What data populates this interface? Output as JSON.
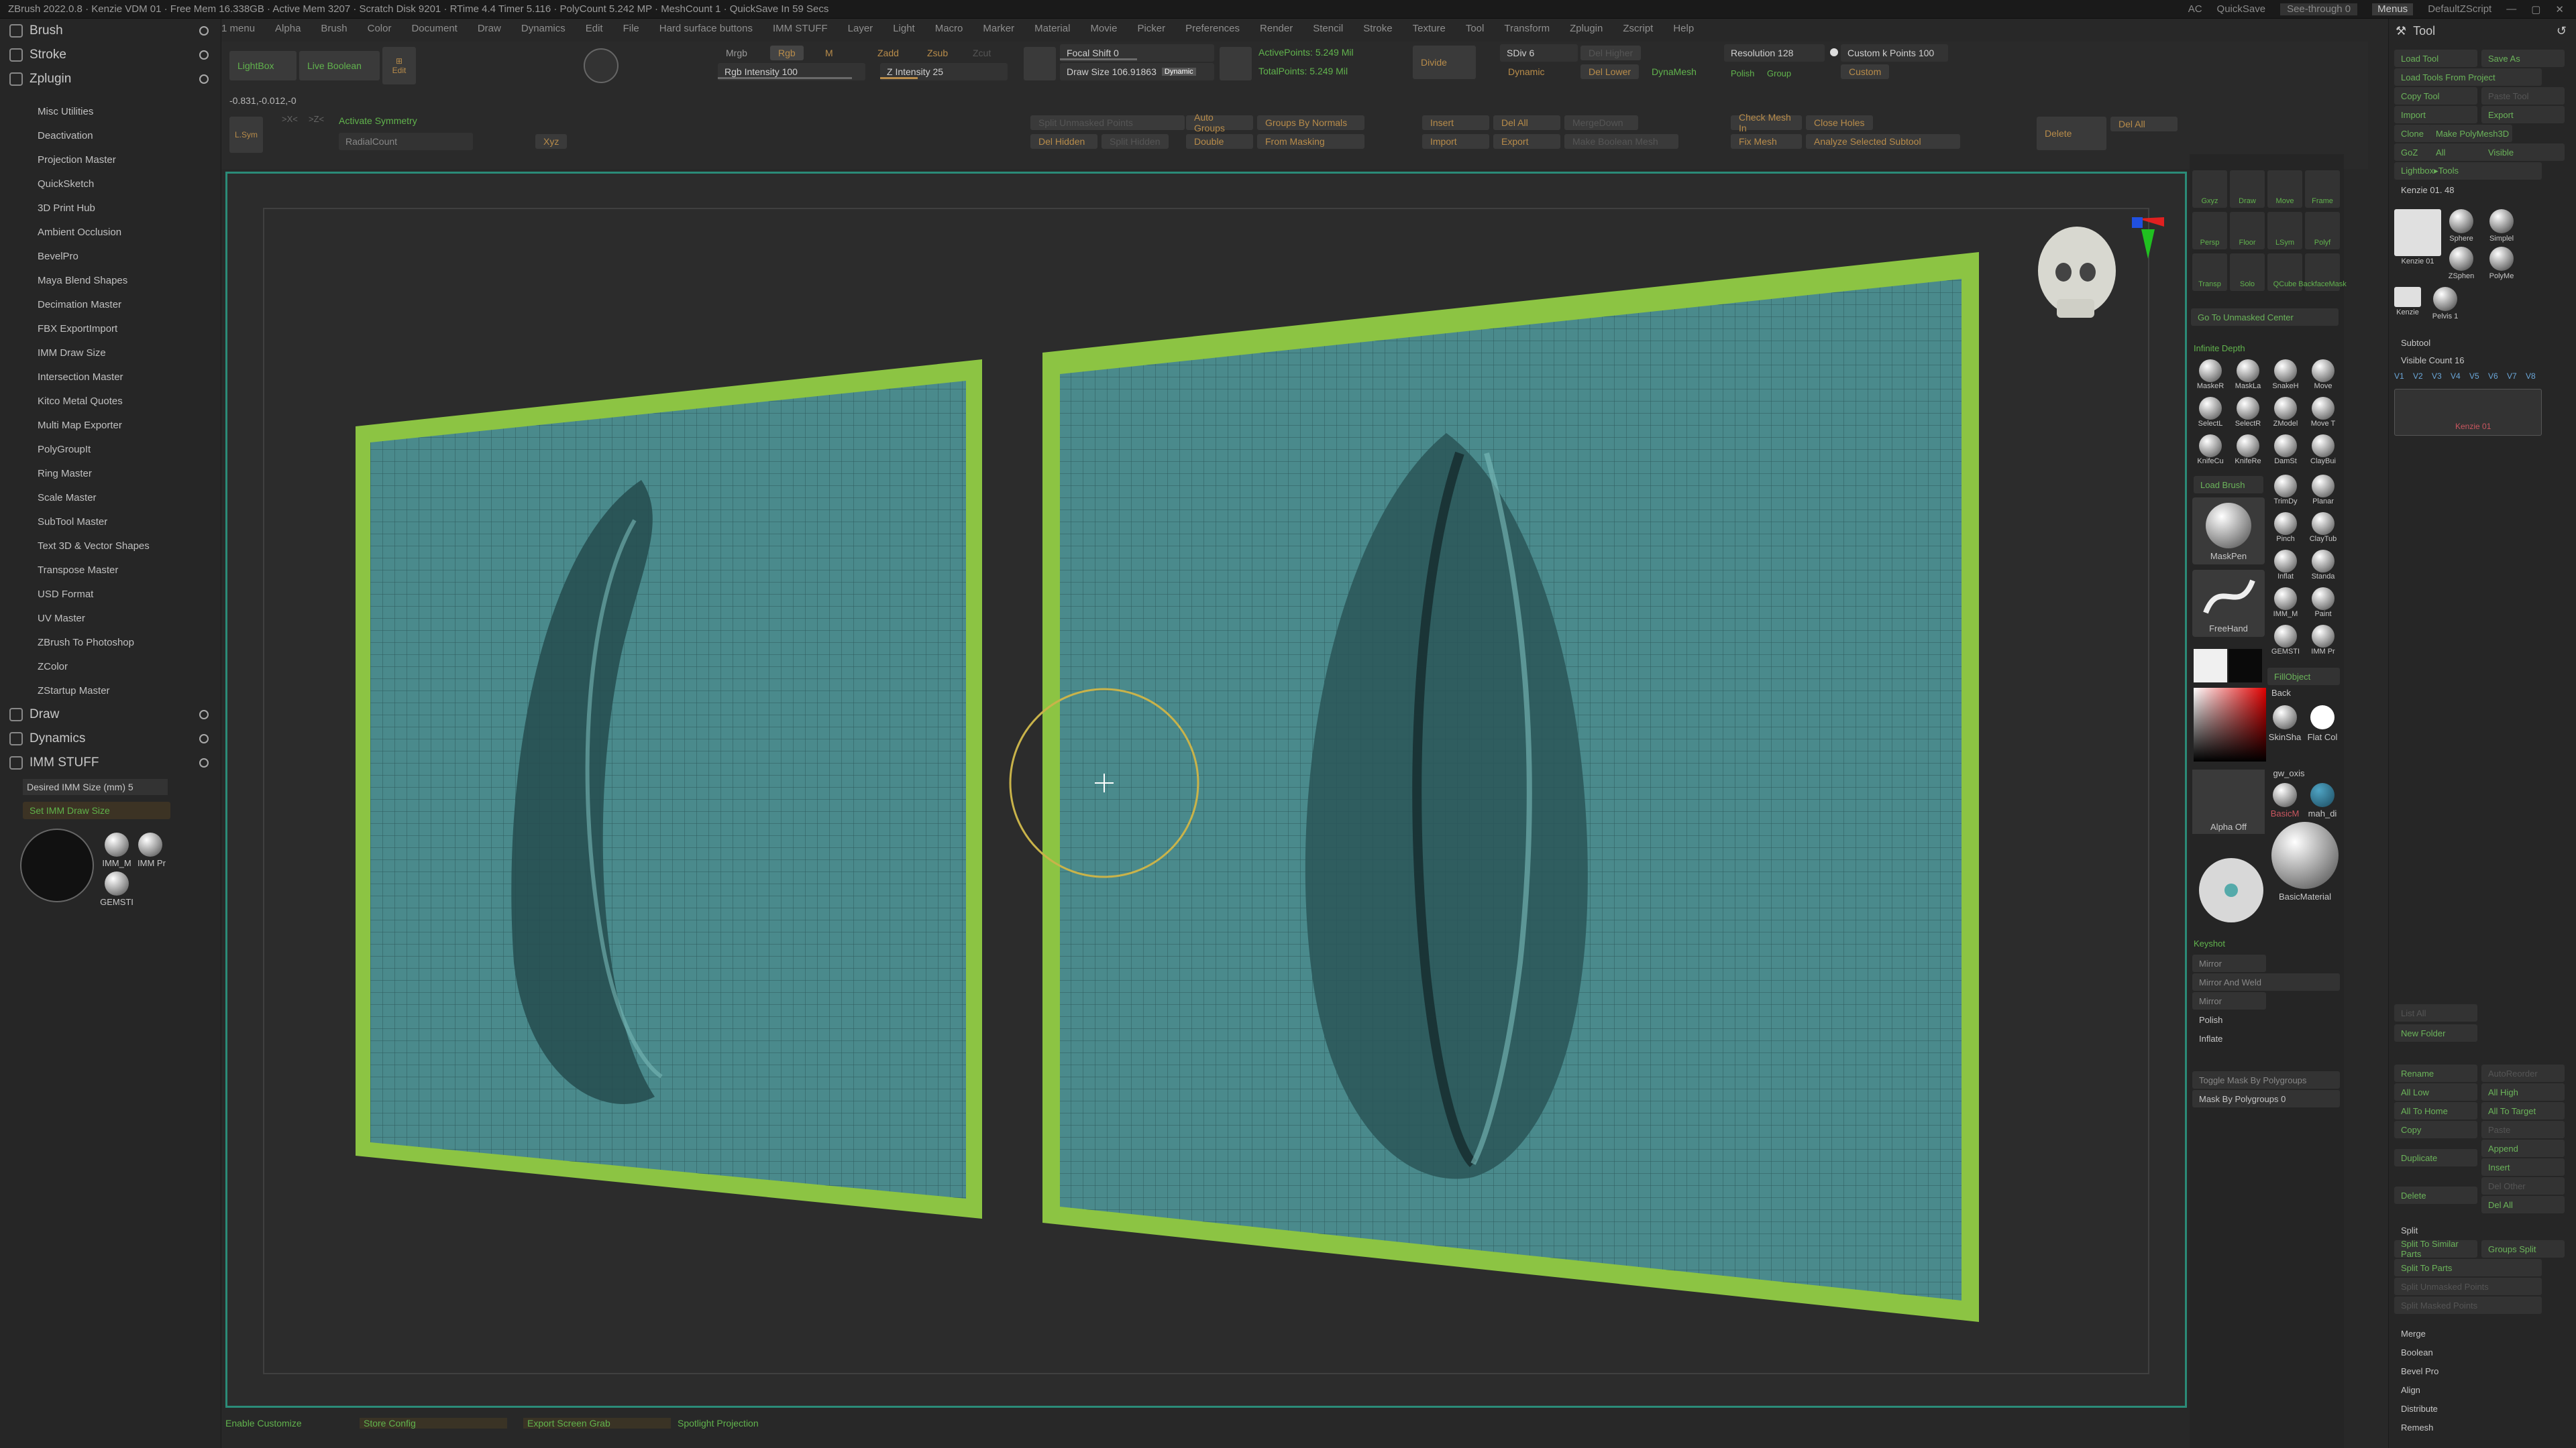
{
  "title_bar": {
    "text": "ZBrush 2022.0.8 · Kenzie VDM 01 · Free Mem 16.338GB · Active Mem 3207 · Scratch Disk 9201 · RTime 4.4 Timer 5.116 · PolyCount 5.242 MP · MeshCount 1 · QuickSave In 59 Secs",
    "ac": "AC",
    "quicksave": "QuickSave",
    "seethrough": "See-through 0",
    "menus": "Menus",
    "script": "DefaultZScript"
  },
  "menu": [
    "1 menu",
    "Alpha",
    "Brush",
    "Color",
    "Document",
    "Draw",
    "Dynamics",
    "Edit",
    "File",
    "Hard surface buttons",
    "IMM STUFF",
    "Layer",
    "Light",
    "Macro",
    "Marker",
    "Material",
    "Movie",
    "Picker",
    "Preferences",
    "Render",
    "Stencil",
    "Stroke",
    "Texture",
    "Tool",
    "Transform",
    "Zplugin",
    "Zscript",
    "Help"
  ],
  "left_panel": {
    "brush": "Brush",
    "stroke": "Stroke",
    "zplugin": "Zplugin",
    "plugins": [
      "Misc Utilities",
      "Deactivation",
      "Projection Master",
      "QuickSketch",
      "3D Print Hub",
      "Ambient Occlusion",
      "BevelPro",
      "Maya Blend Shapes",
      "Decimation Master",
      "FBX ExportImport",
      "IMM Draw Size",
      "Intersection Master",
      "Kitco Metal Quotes",
      "Multi Map Exporter",
      "PolyGroupIt",
      "Ring Master",
      "Scale Master",
      "SubTool Master",
      "Text 3D & Vector Shapes",
      "Transpose Master",
      "USD Format",
      "UV Master",
      "ZBrush To Photoshop",
      "ZColor",
      "ZStartup Master"
    ],
    "draw": "Draw",
    "dynamics": "Dynamics",
    "imm": "IMM STUFF",
    "imm_size": "Desired IMM Size (mm) 5",
    "set_imm": "Set IMM Draw Size",
    "thumb_labels": [
      "IMM_M",
      "IMM Pr",
      "GEMSTI"
    ]
  },
  "top_shelf": {
    "lightbox": "LightBox",
    "live_boolean": "Live Boolean",
    "edit": "Edit",
    "coords": "-0.831,-0.012,-0",
    "lsym": "L.Sym",
    "activate_symmetry": "Activate Symmetry",
    "radial_count": "RadialCount",
    "xyz": "Xyz",
    "mrgb": "Mrgb",
    "rgb": "Rgb",
    "m": "M",
    "zadd": "Zadd",
    "zsub": "Zsub",
    "zcut": "Zcut",
    "rgb_intensity": "Rgb Intensity 100",
    "z_intensity": "Z Intensity 25",
    "focal_shift": "Focal Shift 0",
    "draw_size": "Draw Size 106.91863",
    "dynamic": "Dynamic",
    "active_points": "ActivePoints: 5.249 Mil",
    "total_points": "TotalPoints: 5.249 Mil",
    "divide": "Divide",
    "sdiv": "SDiv 6",
    "del_higher": "Del Higher",
    "del_lower": "Del Lower",
    "dynamesh": "DynaMesh",
    "resolution": "Resolution 128",
    "polish": "Polish",
    "group": "Group",
    "custom_k": "Custom k Points 100",
    "custom": "Custom",
    "split_unmasked": "Split Unmasked Points",
    "auto_groups": "Auto Groups",
    "groups_by_normals": "Groups By Normals",
    "del_hidden": "Del Hidden",
    "split_hidden": "Split Hidden",
    "double": "Double",
    "from_masking": "From Masking",
    "insert": "Insert",
    "import": "Import",
    "del_all": "Del All",
    "export": "Export",
    "merge_down": "MergeDown",
    "make_boolean": "Make Boolean Mesh",
    "check_mesh": "Check Mesh In",
    "close_holes": "Close Holes",
    "fix_mesh": "Fix Mesh",
    "analyze": "Analyze Selected Subtool",
    "delete": "Delete",
    "del_all2": "Del All"
  },
  "right_tools": {
    "labels": [
      "Gxyz",
      "Draw",
      "Move",
      "Frame",
      "Persp",
      "Floor",
      "LSym",
      "Polyf",
      "Transp",
      "Solo",
      "QCube",
      "BackfaceMask"
    ],
    "go_unmasked": "Go To Unmasked Center",
    "infinite_depth": "Infinite Depth",
    "brushes": [
      "MaskeR",
      "MaskLa",
      "SnakeH",
      "Move",
      "SelectL",
      "SelectR",
      "ZModel",
      "Move T",
      "KnifeCu",
      "KnifeRe",
      "DamSt",
      "ClayBui",
      "TrimDy",
      "Planar",
      "Pinch",
      "ClayTub",
      "Inflat",
      "Standa",
      "IMM_M",
      "Paint",
      "GEMSTI",
      "IMM Pr"
    ],
    "load_brush": "Load Brush",
    "maskpen": "MaskPen",
    "freehand": "FreeHand",
    "fill_object": "FillObject",
    "back": "Back",
    "skinsha": "SkinSha",
    "flatcol": "Flat Col",
    "gw_oxis": "gw_oxis",
    "basicm": "BasicM",
    "mah_di": "mah_di",
    "alpha_off": "Alpha Off",
    "basic_material": "BasicMaterial",
    "keyshot": "Keyshot",
    "mirror": "Mirror",
    "mirror_weld": "Mirror And Weld",
    "polish_label": "Polish",
    "inflate": "Inflate",
    "toggle_mask": "Toggle Mask By Polygroups",
    "mask_by_poly": "Mask By Polygroups 0"
  },
  "right_panel": {
    "tool": "Tool",
    "load_tool": "Load Tool",
    "save_as": "Save As",
    "load_from_project": "Load Tools From Project",
    "copy_tool": "Copy Tool",
    "paste_tool": "Paste Tool",
    "import": "Import",
    "export": "Export",
    "clone": "Clone",
    "make_polymesh": "Make PolyMesh3D",
    "goz": "GoZ",
    "all": "All",
    "visible": "Visible",
    "r": "R",
    "lightbox_tools": "Lightbox▸Tools",
    "kenzie_slider": "Kenzie 01. 48",
    "thumbs": [
      "Kenzie 01",
      "Sphere",
      "Simplel",
      "ZSphen",
      "PolyMe",
      "Kenzie",
      "Pelvis 1"
    ],
    "subtool": "Subtool",
    "visible_count": "Visible Count 16",
    "versions": [
      "V1",
      "V2",
      "V3",
      "V4",
      "V5",
      "V6",
      "V7",
      "V8"
    ],
    "active_subtool": "Kenzie 01",
    "list_all": "List All",
    "new_folder": "New Folder",
    "rename": "Rename",
    "auto_reorder": "AutoReorder",
    "all_low": "All Low",
    "all_high": "All High",
    "all_to_home": "All To Home",
    "all_to_target": "All To Target",
    "copy": "Copy",
    "paste": "Paste",
    "append": "Append",
    "duplicate": "Duplicate",
    "insert": "Insert",
    "del_other": "Del Other",
    "delete": "Delete",
    "del_all": "Del All",
    "split": "Split",
    "split_to_similar": "Split To Similar Parts",
    "groups_split": "Groups Split",
    "split_to_parts": "Split To Parts",
    "split_unmasked": "Split Unmasked Points",
    "split_masked": "Split Masked Points",
    "merge": "Merge",
    "boolean": "Boolean",
    "bevel_pro": "Bevel Pro",
    "align": "Align",
    "distribute": "Distribute",
    "remesh": "Remesh"
  },
  "bottom": {
    "enable_customize": "Enable Customize",
    "store_config": "Store Config",
    "export_screen_grab": "Export Screen Grab",
    "spotlight": "Spotlight Projection"
  },
  "colors": {
    "mesh": "#3f7a7d",
    "border_green": "#8cc443",
    "accent": "#61b34d",
    "viewport_frame": "#2b8b78"
  }
}
